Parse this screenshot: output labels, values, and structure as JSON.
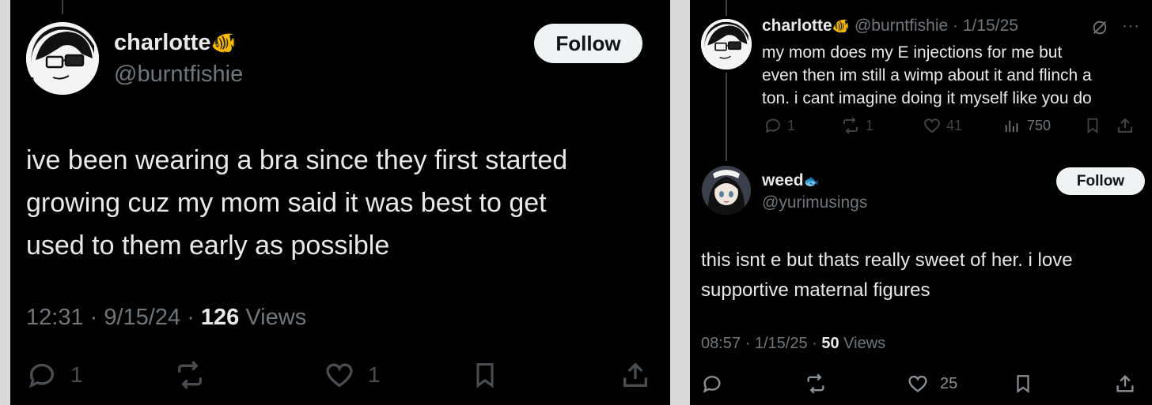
{
  "left_post": {
    "author": {
      "display_name": "charlotte",
      "badge_emoji": "🐠",
      "handle": "@burntfishie"
    },
    "follow_label": "Follow",
    "text_lines": [
      "ive been wearing a bra since they first started",
      "growing cuz my mom said it was best to get",
      "used to them early as possible"
    ],
    "time": "12:31",
    "date": "9/15/24",
    "views_count": "126",
    "views_label": "Views",
    "actions": {
      "replies": "1",
      "reposts": "",
      "likes": "1",
      "icons": [
        "reply-icon",
        "repost-icon",
        "like-icon",
        "bookmark-icon",
        "share-icon"
      ]
    }
  },
  "right_thread": {
    "parent_post": {
      "author": {
        "display_name": "charlotte",
        "badge_emoji": "🐠",
        "handle": "@burntfishie",
        "separator": "·",
        "date": "1/15/25"
      },
      "text_lines": [
        "my mom does my E injections for me but",
        "even then im still a wimp about it and flinch a",
        "ton. i cant imagine doing it myself like you do"
      ],
      "actions": {
        "replies": "1",
        "reposts": "1",
        "likes": "41",
        "views": "750"
      }
    },
    "reply_post": {
      "author": {
        "display_name": "weed",
        "badge_emoji": "🐟",
        "handle": "@yurimusings"
      },
      "follow_label": "Follow",
      "text_lines": [
        "this isnt e but thats really sweet of her. i love",
        "supportive maternal figures"
      ],
      "time": "08:57",
      "date": "1/15/25",
      "views_count": "50",
      "views_label": "Views",
      "actions": {
        "replies": "",
        "reposts": "",
        "likes": "25"
      }
    }
  },
  "colors": {
    "background": "#000000",
    "text": "#e7e9ea",
    "muted": "#71767b",
    "follow_bg": "#eff3f4",
    "divider": "#d9d9d9"
  }
}
